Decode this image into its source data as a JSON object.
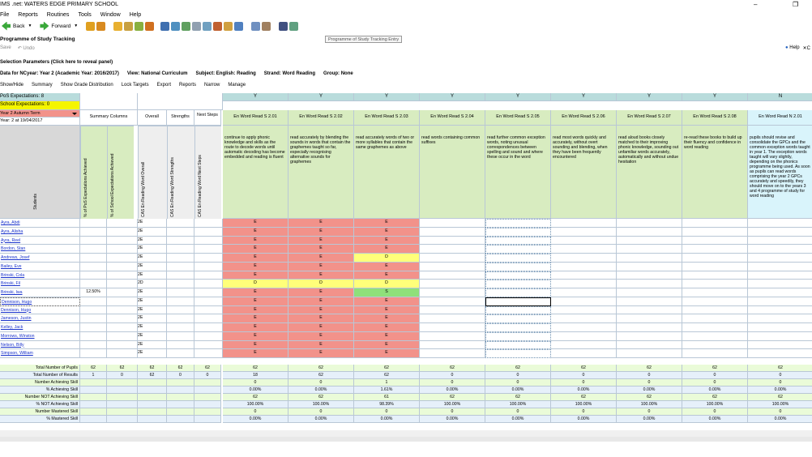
{
  "window": {
    "title": "IMS .net: WATERS EDGE PRIMARY SCHOOL",
    "min": "–",
    "max": "❐"
  },
  "menu": [
    "File",
    "Reports",
    "Routines",
    "Tools",
    "Window",
    "Help"
  ],
  "toolbar": {
    "back": "Back",
    "forward": "Forward"
  },
  "tooltip": "Programme of Study Tracking Entry",
  "page": {
    "title": "Programme of Study Tracking",
    "save": "Save",
    "undo": "Undo",
    "help": "Help",
    "close": "C"
  },
  "selection": {
    "heading": "Selection Parameters (Click here to reveal panel)",
    "line": "Data for NCyear: Year 2 (Academic Year: 2016/2017)",
    "view": "View: National Curriculum",
    "subject": "Subject: English: Reading",
    "strand": "Strand: Word Reading",
    "group": "Group: None"
  },
  "options": [
    "Show/Hide",
    "Summary",
    "Show Grade Distribution",
    "Lock Targets",
    "Export",
    "Reports",
    "Narrow",
    "Manage"
  ],
  "grid": {
    "pos_label": "PoS Expectations: 8",
    "school_label": "School Expectations: 0",
    "term": "Year 2 Autumn Term",
    "date": "Year: 2 at 19/04/2017",
    "students_label": "Students",
    "summary_label": "Summary Columns",
    "overall": "Overall",
    "strengths": "Strengths",
    "next_steps": "Next Steps",
    "vert_labels": [
      "% of PoS Expectations Achieved",
      "% of School Expectations Achieved",
      "CAS En Reading Word Overall",
      "CAS En Reading Word Strengths",
      "CAS En Reading Word Next Steps"
    ],
    "columns": [
      {
        "y": "Y",
        "n": "N",
        "code": "En Word Read S 2.01",
        "desc": "continue to apply phonic knowledge and skills as the route to decode words until automatic decoding has become embedded and reading is fluent"
      },
      {
        "y": "Y",
        "n": "N",
        "code": "En Word Read S 2.02",
        "desc": "read accurately by blending the sounds in words that contain the graphemes taught so far, especially recognising alternative sounds for graphemes"
      },
      {
        "y": "Y",
        "n": "N",
        "code": "En Word Read S 2.03",
        "desc": "read accurately words of two or more syllables that contain the same graphemes as above"
      },
      {
        "y": "Y",
        "n": "N",
        "code": "En Word Read S 2.04",
        "desc": "read words containing common suffixes"
      },
      {
        "y": "Y",
        "n": "N",
        "code": "En Word Read S 2.05",
        "desc": "read further common exception words, noting unusual correspondences between spelling and sound and where these occur in the word"
      },
      {
        "y": "Y",
        "n": "N",
        "code": "En Word Read S 2.06",
        "desc": "read most words quickly and accurately, without overt sounding and blending, when they have been frequently encountered"
      },
      {
        "y": "Y",
        "n": "N",
        "code": "En Word Read S 2.07",
        "desc": "read aloud books closely matched to their improving phonic knowledge, sounding out unfamiliar words accurately, automatically and without undue hesitation"
      },
      {
        "y": "Y",
        "n": "N",
        "code": "En Word Read S 2.08",
        "desc": "re-read these books to build up their fluency and confidence in word reading"
      },
      {
        "y": "N",
        "n": "N",
        "code": "En Word Read N 2.01",
        "desc": "pupils should revise and consolidate the GPCs and the common exception words taught in year 1. The exception words taught will vary slightly, depending on the phonics programme being used. As soon as pupils can read words comprising the year 2 GPCs accurately and speedily, they should move on to the years 3 and 4 programme of study for word reading"
      }
    ],
    "students": [
      {
        "name": "Ayra, Abdi",
        "pos": "",
        "overall": "2E",
        "g": [
          "E",
          "E",
          "E"
        ]
      },
      {
        "name": "Ayra, Alisha",
        "pos": "",
        "overall": "2E",
        "g": [
          "E",
          "E",
          "E"
        ]
      },
      {
        "name": "Ayra, Reel",
        "pos": "",
        "overall": "2E",
        "g": [
          "E",
          "E",
          "E"
        ]
      },
      {
        "name": "Bordon, Stan",
        "pos": "",
        "overall": "2E",
        "g": [
          "E",
          "E",
          "E"
        ]
      },
      {
        "name": "Andrews, Josef",
        "pos": "",
        "overall": "2E",
        "g": [
          "E",
          "E",
          "D"
        ]
      },
      {
        "name": "Bailey, Eve",
        "pos": "",
        "overall": "2E",
        "g": [
          "E",
          "E",
          "E"
        ]
      },
      {
        "name": "Brinski, Cola",
        "pos": "",
        "overall": "2E",
        "g": [
          "E",
          "E",
          "E"
        ]
      },
      {
        "name": "Brinski, Fil",
        "pos": "",
        "overall": "2D",
        "g": [
          "D",
          "D",
          "D"
        ]
      },
      {
        "name": "Brinski, Iwa",
        "pos": "12.50%",
        "overall": "2E",
        "g": [
          "E",
          "E",
          "S"
        ]
      },
      {
        "name": "Dennison, Hugo",
        "pos": "",
        "overall": "2E",
        "g": [
          "E",
          "E",
          "E"
        ]
      },
      {
        "name": "Dennison, Hugo",
        "pos": "",
        "overall": "2E",
        "g": [
          "E",
          "E",
          "E"
        ]
      },
      {
        "name": "Jameson, Justin",
        "pos": "",
        "overall": "2E",
        "g": [
          "E",
          "E",
          "E"
        ]
      },
      {
        "name": "Kelley, Jack",
        "pos": "",
        "overall": "2E",
        "g": [
          "E",
          "E",
          "E"
        ]
      },
      {
        "name": "Morrows, Winston",
        "pos": "",
        "overall": "2E",
        "g": [
          "E",
          "E",
          "E"
        ]
      },
      {
        "name": "Nelson, Billy",
        "pos": "",
        "overall": "2E",
        "g": [
          "E",
          "E",
          "E"
        ]
      },
      {
        "name": "Simpson, William",
        "pos": "",
        "overall": "2E",
        "g": [
          "E",
          "E",
          "E"
        ]
      }
    ],
    "stats": [
      {
        "label": "Total Number of Pupils",
        "summary": [
          "62",
          "62"
        ],
        "mid": [
          "62",
          "62",
          "62"
        ],
        "vals": [
          "62",
          "62",
          "62",
          "62",
          "62",
          "62",
          "62",
          "62",
          "62"
        ]
      },
      {
        "label": "Total Number of Results",
        "summary": [
          "1",
          "0"
        ],
        "mid": [
          "62",
          "0",
          "0"
        ],
        "vals": [
          "18",
          "62",
          "62",
          "0",
          "0",
          "0",
          "0",
          "0",
          "0"
        ]
      },
      {
        "label": "Number Achieving Skill",
        "summary": [
          "",
          ""
        ],
        "mid": [
          "",
          "",
          ""
        ],
        "vals": [
          "0",
          "0",
          "1",
          "0",
          "0",
          "0",
          "0",
          "0",
          "0"
        ]
      },
      {
        "label": "% Achieving Skill",
        "summary": [
          "",
          ""
        ],
        "mid": [
          "",
          "",
          ""
        ],
        "vals": [
          "0.00%",
          "0.00%",
          "1.61%",
          "0.00%",
          "0.00%",
          "0.00%",
          "0.00%",
          "0.00%",
          "0.00%"
        ]
      },
      {
        "label": "Number NOT Achieving Skill",
        "summary": [
          "",
          ""
        ],
        "mid": [
          "",
          "",
          ""
        ],
        "vals": [
          "62",
          "62",
          "61",
          "62",
          "62",
          "62",
          "62",
          "62",
          "62"
        ]
      },
      {
        "label": "% NOT Achieving Skill",
        "summary": [
          "",
          ""
        ],
        "mid": [
          "",
          "",
          ""
        ],
        "vals": [
          "100.00%",
          "100.00%",
          "98.39%",
          "100.00%",
          "100.00%",
          "100.00%",
          "100.00%",
          "100.00%",
          "100.00%"
        ]
      },
      {
        "label": "Number Mastered Skill",
        "summary": [
          "",
          ""
        ],
        "mid": [
          "",
          "",
          ""
        ],
        "vals": [
          "0",
          "0",
          "0",
          "0",
          "0",
          "0",
          "0",
          "0",
          "0"
        ]
      },
      {
        "label": "% Mastered Skill",
        "summary": [
          "",
          ""
        ],
        "mid": [
          "",
          "",
          ""
        ],
        "vals": [
          "0.00%",
          "0.00%",
          "0.00%",
          "0.00%",
          "0.00%",
          "0.00%",
          "0.00%",
          "0.00%",
          "0.00%"
        ]
      }
    ]
  }
}
